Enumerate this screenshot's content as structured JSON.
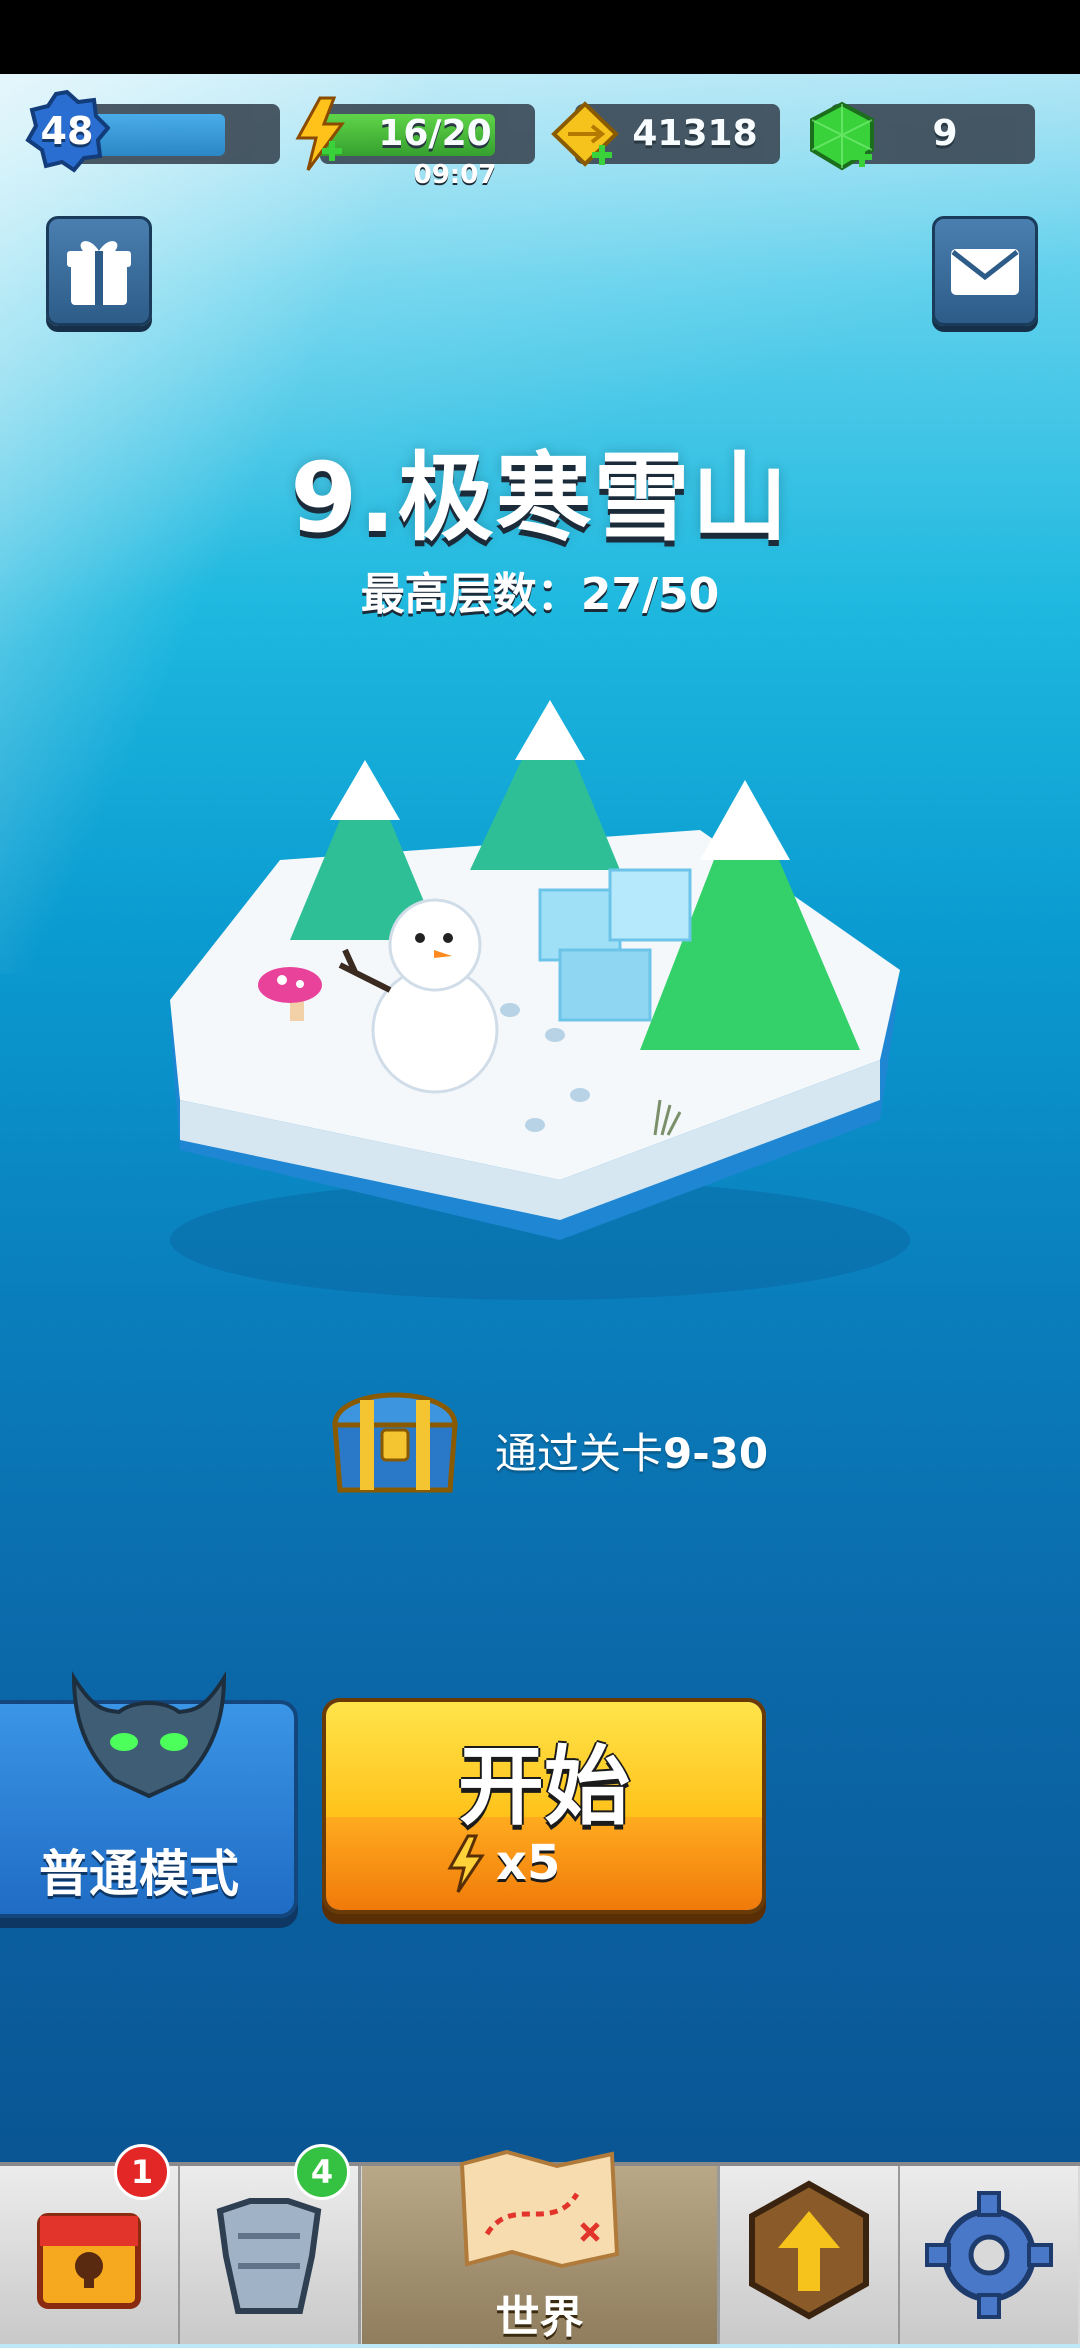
{
  "hud": {
    "player_level": "48",
    "energy": "16/20",
    "energy_timer": "09:07",
    "coins": "41318",
    "gems": "9"
  },
  "stage": {
    "title": "9.极寒雪山",
    "best_floor_label": "最高层数：",
    "best_floor_value": "27/50"
  },
  "reward": {
    "text_prefix": "通过关卡",
    "level": "9-30"
  },
  "actions": {
    "mode_label": "普通模式",
    "start_label": "开始",
    "start_cost": "x5"
  },
  "nav": {
    "chest_badge": "1",
    "armor_badge": "4",
    "world_label": "世界"
  },
  "colors": {
    "energy": "#2c9b1e",
    "level_bar": "#1f7fc2",
    "start_button": "#ffc21a",
    "mode_button": "#1f6cc4",
    "badge_red": "#e32626",
    "badge_green": "#35c141"
  }
}
